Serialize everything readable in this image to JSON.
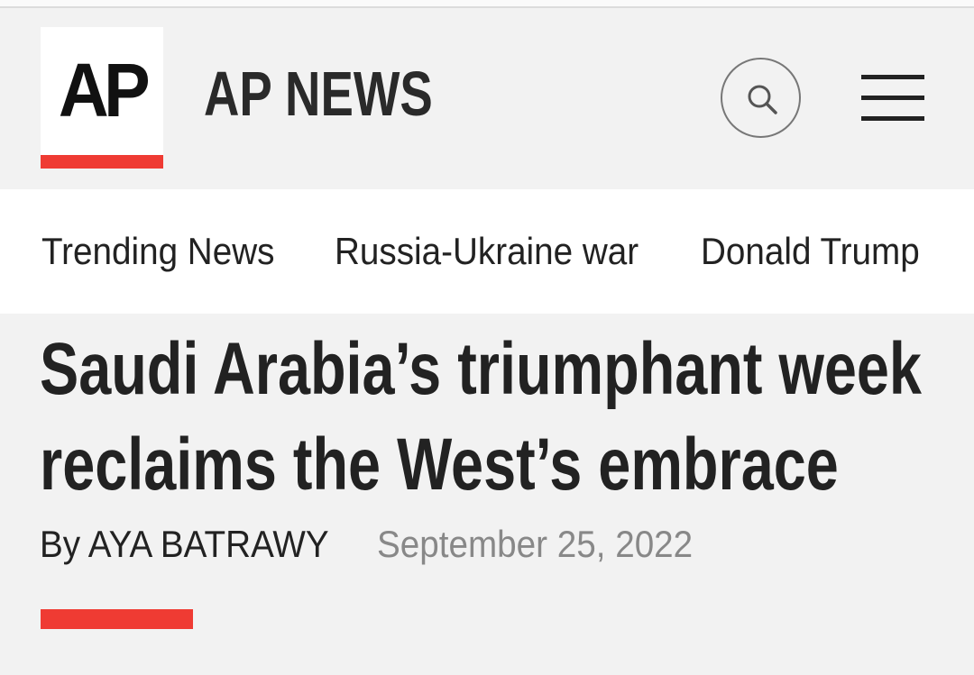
{
  "header": {
    "logo_text": "AP",
    "site_title": "AP NEWS",
    "search_icon": "search-icon",
    "menu_icon": "hamburger-menu-icon"
  },
  "nav": {
    "items": [
      {
        "label": "Trending News"
      },
      {
        "label": "Russia-Ukraine war"
      },
      {
        "label": "Donald Trump"
      }
    ]
  },
  "article": {
    "headline_line1": "Saudi Arabia’s triumphant week",
    "headline_line2": "reclaims the West’s embrace",
    "byline": "By AYA BATRAWY",
    "date": "September 25, 2022"
  },
  "colors": {
    "accent": "#ef3b33",
    "background": "#f2f2f2",
    "nav_background": "#ffffff",
    "text": "#222222",
    "date_text": "#888888"
  }
}
